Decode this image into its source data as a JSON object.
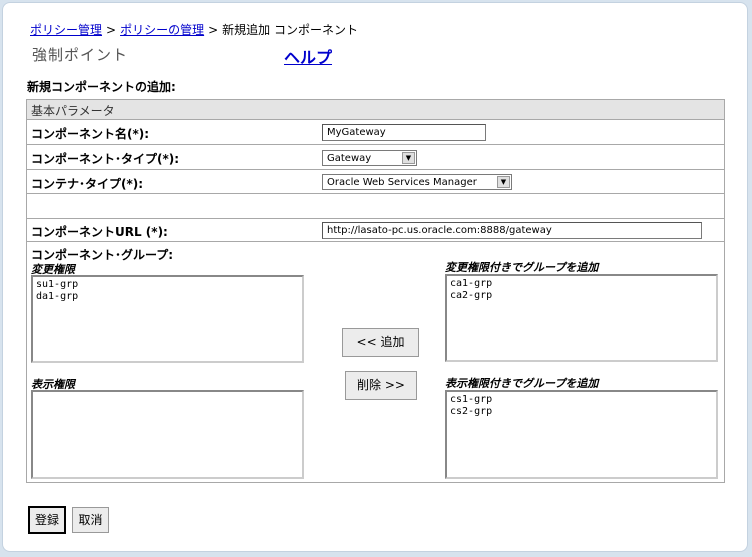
{
  "breadcrumb": {
    "item1": "ポリシー管理",
    "sep1": ">",
    "item2": "ポリシーの管理",
    "sep2": ">",
    "current": "新規追加 コンポーネント"
  },
  "header": {
    "title": "強制ポイント",
    "help": "ヘルプ"
  },
  "section_title": "新規コンポーネントの追加:",
  "panel": {
    "header": "基本パラメータ",
    "fields": {
      "component_name_label": "コンポーネント名(*):",
      "component_name_value": "MyGateway",
      "component_type_label": "コンポーネント･タイプ(*):",
      "component_type_value": "Gateway",
      "container_type_label": "コンテナ･タイプ(*):",
      "container_type_value": "Oracle Web Services Manager",
      "component_url_label": "コンポーネントURL (*):",
      "component_url_value": "http://lasato-pc.us.oracle.com:8888/gateway"
    },
    "groups": {
      "label": "コンポーネント･グループ:",
      "modify_caption": "変更権限",
      "modify_items": [
        "su1-grp",
        "da1-grp"
      ],
      "modify_assigned_caption": "変更権限付きでグループを追加",
      "modify_assigned_items": [
        "ca1-grp",
        "ca2-grp"
      ],
      "view_caption": "表示権限",
      "view_items": [],
      "view_assigned_caption": "表示権限付きでグループを追加",
      "view_assigned_items": [
        "cs1-grp",
        "cs2-grp"
      ],
      "add_button": "<<  追加",
      "remove_button": "削除  >>"
    }
  },
  "footer": {
    "register_button": "登録",
    "cancel_button": "取消"
  }
}
